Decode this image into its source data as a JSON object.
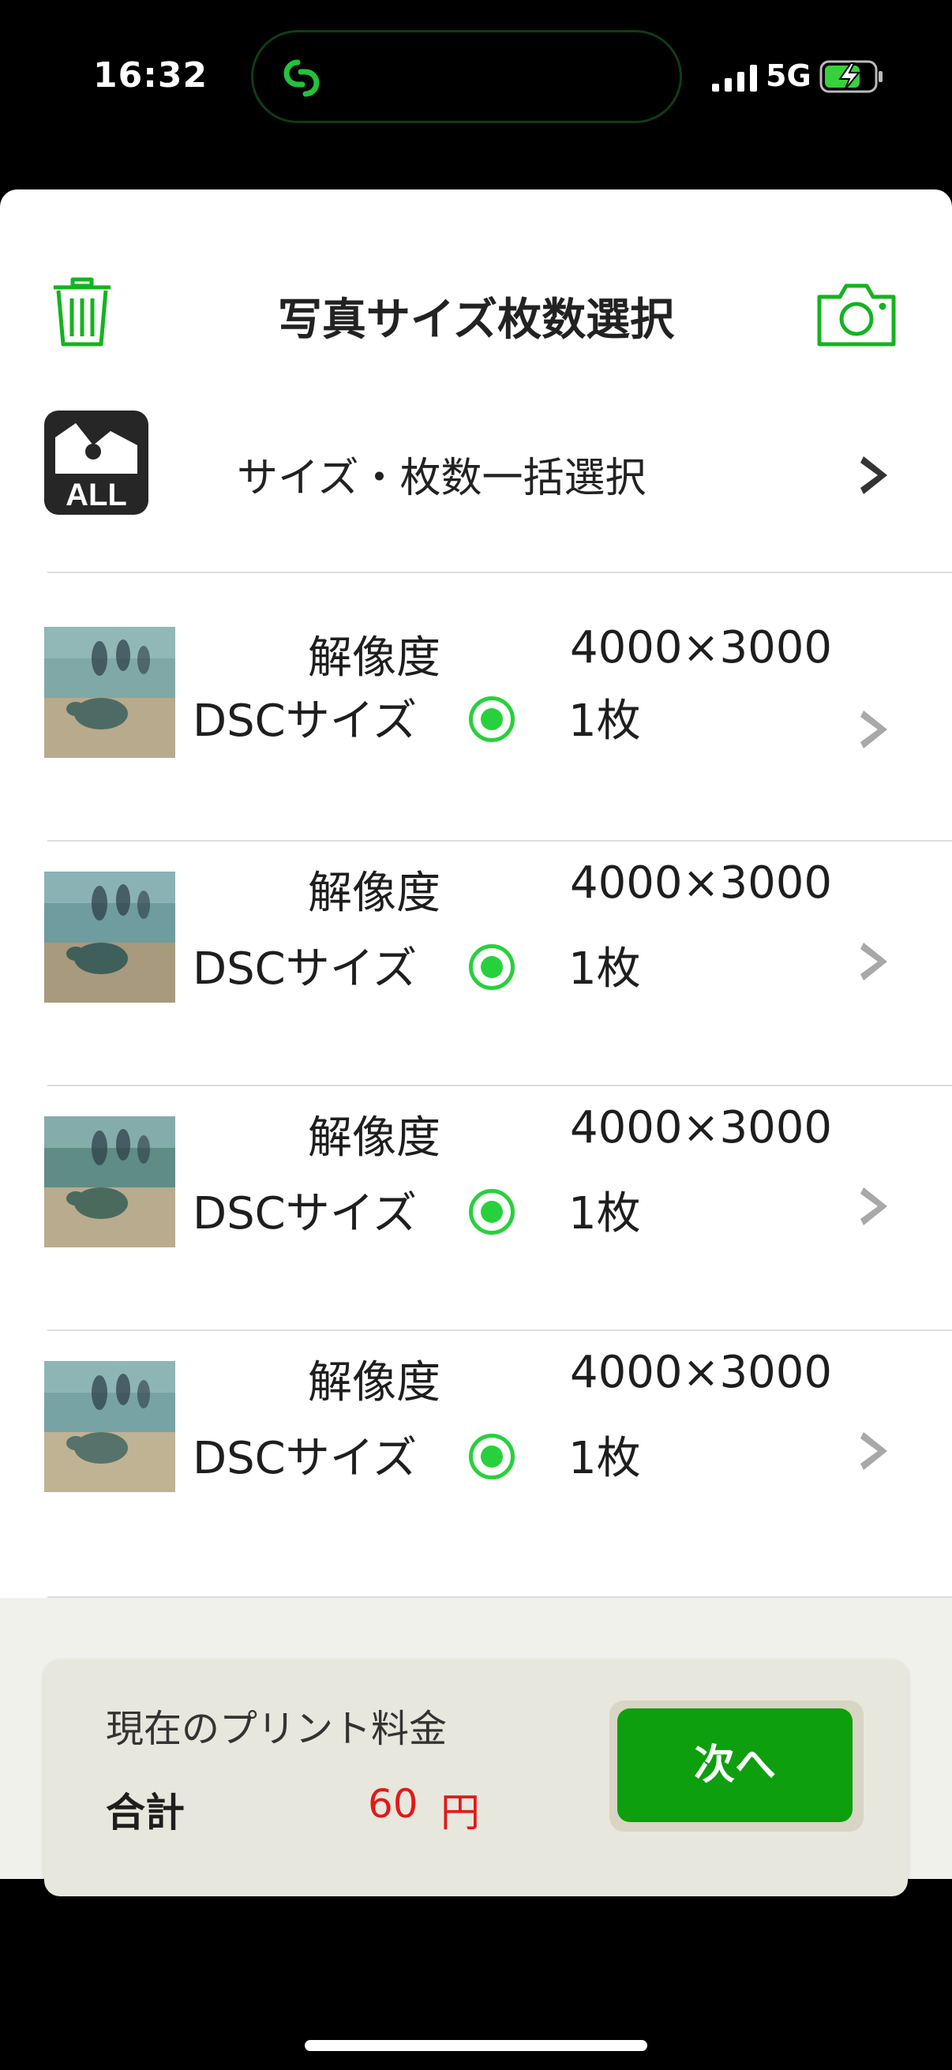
{
  "status_bar": {
    "time": "16:32",
    "network": "5G",
    "icons": [
      "app-link-icon",
      "signal-icon",
      "battery-charging-icon"
    ]
  },
  "header": {
    "title": "写真サイズ枚数選択",
    "left_icon": "trash-icon",
    "right_icon": "camera-icon"
  },
  "bulk_select": {
    "icon_text": "ALL",
    "label": "サイズ・枚数一括選択"
  },
  "photos": [
    {
      "resolution_label": "解像度",
      "resolution": "4000×3000",
      "size": "DSCサイズ",
      "count": "1枚",
      "selected": true
    },
    {
      "resolution_label": "解像度",
      "resolution": "4000×3000",
      "size": "DSCサイズ",
      "count": "1枚",
      "selected": true
    },
    {
      "resolution_label": "解像度",
      "resolution": "4000×3000",
      "size": "DSCサイズ",
      "count": "1枚",
      "selected": true
    },
    {
      "resolution_label": "解像度",
      "resolution": "4000×3000",
      "size": "DSCサイズ",
      "count": "1枚",
      "selected": true
    }
  ],
  "price": {
    "heading": "現在のプリント料金",
    "total_label": "合計",
    "total_value": "60",
    "unit": "円"
  },
  "next_button": {
    "label": "次へ"
  },
  "colors": {
    "accent_green": "#0d9f0d",
    "radio_green": "#27d13b",
    "price_red": "#e01a1a",
    "icon_green": "#14b31f"
  }
}
